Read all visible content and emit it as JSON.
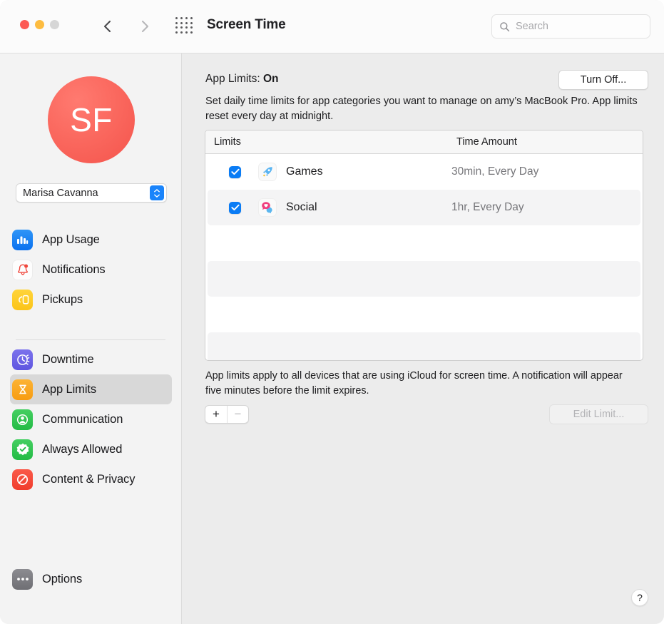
{
  "window": {
    "title": "Screen Time",
    "traffic_lights": [
      "close-red",
      "minimize-yellow",
      "zoom-gray"
    ],
    "nav_back_icon": "chevron-left-icon",
    "nav_forward_icon": "chevron-right-icon",
    "grid_icon": "app-grid-icon"
  },
  "search": {
    "placeholder": "Search",
    "value": "",
    "icon": "search-icon"
  },
  "sidebar": {
    "avatar": {
      "initials": "SF",
      "color": "#f4544c"
    },
    "user_popup": {
      "value": "Marisa Cavanna",
      "icon": "up-down-chevron-icon"
    },
    "groups": [
      {
        "items": [
          {
            "label": "App Usage",
            "icon": "bar-chart-icon",
            "selected": false
          },
          {
            "label": "Notifications",
            "icon": "bell-badge-icon",
            "selected": false
          },
          {
            "label": "Pickups",
            "icon": "pickup-phone-icon",
            "selected": false
          }
        ]
      },
      {
        "items": [
          {
            "label": "Downtime",
            "icon": "clock-moon-icon",
            "selected": false
          },
          {
            "label": "App Limits",
            "icon": "hourglass-icon",
            "selected": true
          },
          {
            "label": "Communication",
            "icon": "person-circle-icon",
            "selected": false
          },
          {
            "label": "Always Allowed",
            "icon": "checkmark-seal-icon",
            "selected": false
          },
          {
            "label": "Content & Privacy",
            "icon": "no-entry-icon",
            "selected": false
          }
        ]
      },
      {
        "items": [
          {
            "label": "Options",
            "icon": "ellipsis-icon",
            "selected": false
          }
        ]
      }
    ]
  },
  "main": {
    "status_prefix": "App Limits:",
    "status_value": "On",
    "turn_off_label": "Turn Off...",
    "description": "Set daily time limits for app categories you want to manage on amy’s MacBook Pro. App limits reset every day at midnight.",
    "table": {
      "columns": [
        "Limits",
        "Time Amount"
      ],
      "rows": [
        {
          "checked": true,
          "icon": "rocket-app-icon",
          "name": "Games",
          "time": "30min, Every Day"
        },
        {
          "checked": true,
          "icon": "social-chat-icon",
          "name": "Social",
          "time": "1hr, Every Day"
        }
      ],
      "empty_rows": 4
    },
    "footnote": "App limits apply to all devices that are using iCloud for screen time. A notification will appear five minutes before the limit expires.",
    "add_label": "+",
    "remove_label": "−",
    "edit_limit_label": "Edit Limit...",
    "help_label": "?"
  }
}
